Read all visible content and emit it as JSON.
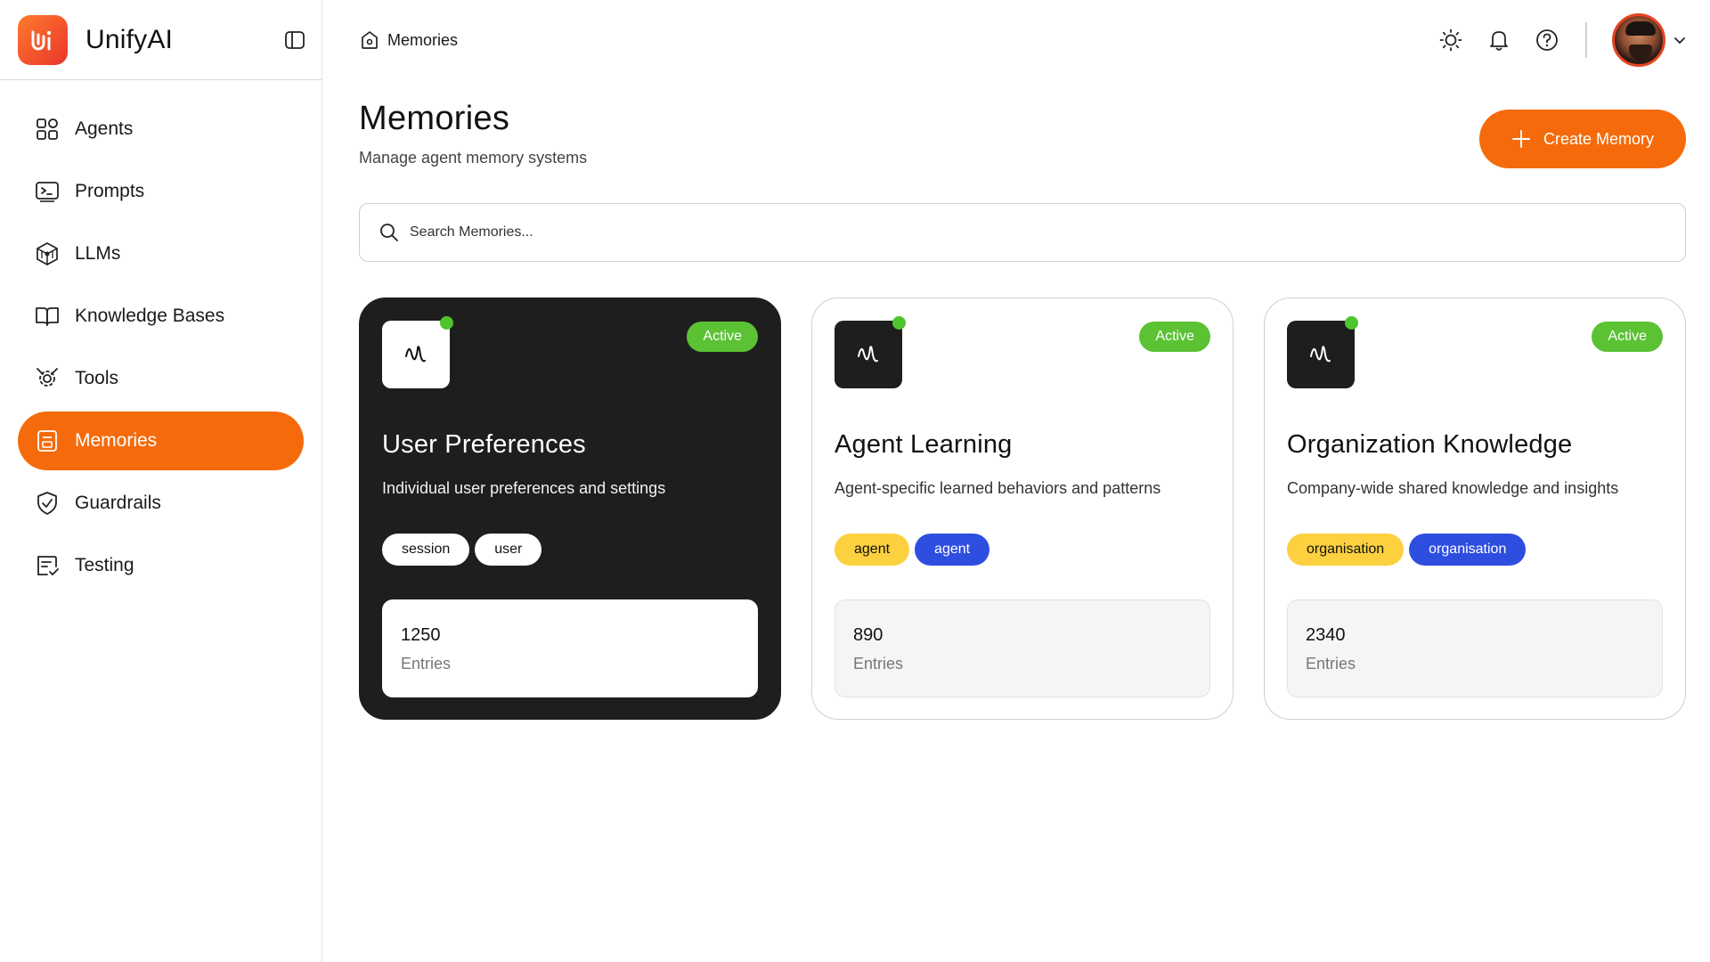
{
  "app": {
    "name": "UnifyAI"
  },
  "sidebar": {
    "items": [
      {
        "label": "Agents",
        "icon": "grid-icon",
        "active": false
      },
      {
        "label": "Prompts",
        "icon": "terminal-icon",
        "active": false
      },
      {
        "label": "LLMs",
        "icon": "cube-network-icon",
        "active": false
      },
      {
        "label": "Knowledge Bases",
        "icon": "book-icon",
        "active": false
      },
      {
        "label": "Tools",
        "icon": "gear-tools-icon",
        "active": false
      },
      {
        "label": "Memories",
        "icon": "memory-icon",
        "active": true
      },
      {
        "label": "Guardrails",
        "icon": "shield-icon",
        "active": false
      },
      {
        "label": "Testing",
        "icon": "test-list-icon",
        "active": false
      }
    ]
  },
  "header": {
    "breadcrumb": "Memories"
  },
  "main": {
    "title": "Memories",
    "subtitle": "Manage agent memory systems",
    "create_label": "Create Memory",
    "search_placeholder": "Search Memories..."
  },
  "cards": [
    {
      "title": "User Preferences",
      "description": "Individual user preferences and settings",
      "status": "Active",
      "tags": [
        "session",
        "user"
      ],
      "entries": "1250",
      "entries_label": "Entries",
      "theme": "dark"
    },
    {
      "title": "Agent Learning",
      "description": "Agent-specific learned behaviors and patterns",
      "status": "Active",
      "tags": [
        "agent",
        "agent"
      ],
      "entries": "890",
      "entries_label": "Entries",
      "theme": "light"
    },
    {
      "title": "Organization Knowledge",
      "description": "Company-wide shared knowledge and insights",
      "status": "Active",
      "tags": [
        "organisation",
        "organisation"
      ],
      "entries": "2340",
      "entries_label": "Entries",
      "theme": "light"
    }
  ],
  "colors": {
    "accent": "#f56b0c",
    "active_badge": "#5bc234",
    "tag_yellow": "#fcd03f",
    "tag_blue": "#2e4ee0",
    "dark_card": "#1e1e1e"
  }
}
